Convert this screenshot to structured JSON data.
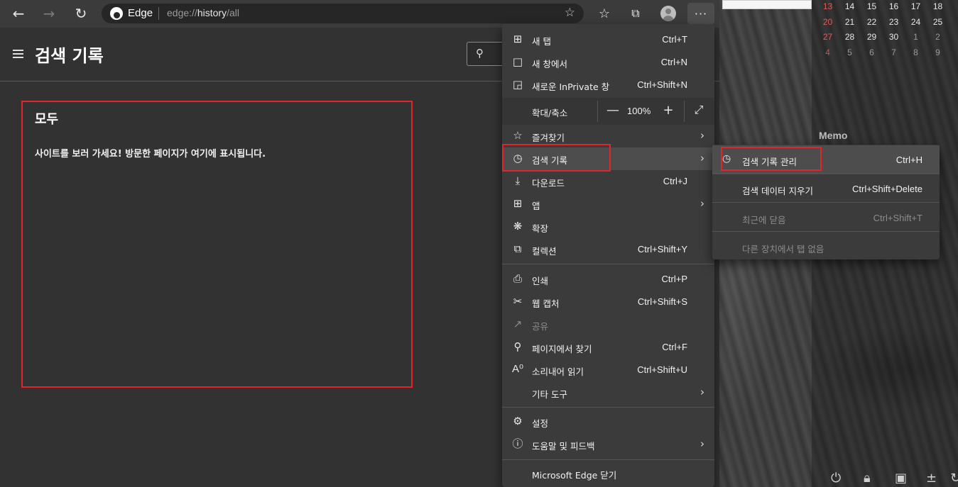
{
  "toolbar": {
    "back_icon": "back-arrow-icon",
    "edge_name": "Edge",
    "url_prefix": "edge://",
    "url_host": "history",
    "url_path": "/all",
    "more_label": "···"
  },
  "page": {
    "title": "검색 기록",
    "section_title": "모두",
    "empty_message": "사이트를 보러 가세요! 방문한 페이지가 여기에 표시됩니다."
  },
  "menu": {
    "new_tab": {
      "label": "새 탭",
      "shortcut": "Ctrl+T"
    },
    "new_window": {
      "label": "새 창에서",
      "shortcut": "Ctrl+N"
    },
    "new_inprivate": {
      "label": "새로운 InPrivate 창",
      "shortcut": "Ctrl+Shift+N"
    },
    "zoom": {
      "label": "확대/축소",
      "value": "100%"
    },
    "favorites": {
      "label": "즐겨찾기"
    },
    "history": {
      "label": "검색 기록"
    },
    "downloads": {
      "label": "다운로드",
      "shortcut": "Ctrl+J"
    },
    "apps": {
      "label": "앱"
    },
    "extensions": {
      "label": "확장"
    },
    "collections": {
      "label": "컬렉션",
      "shortcut": "Ctrl+Shift+Y"
    },
    "print": {
      "label": "인쇄",
      "shortcut": "Ctrl+P"
    },
    "web_capture": {
      "label": "웹 캡처",
      "shortcut": "Ctrl+Shift+S"
    },
    "share": {
      "label": "공유"
    },
    "find": {
      "label": "페이지에서 찾기",
      "shortcut": "Ctrl+F"
    },
    "read_aloud": {
      "label": "소리내어 읽기",
      "shortcut": "Ctrl+Shift+U"
    },
    "more_tools": {
      "label": "기타 도구"
    },
    "settings": {
      "label": "설정"
    },
    "help": {
      "label": "도움말 및 피드백"
    },
    "close": {
      "label": "Microsoft Edge 닫기"
    }
  },
  "submenu": {
    "manage_history": {
      "label": "검색 기록 관리",
      "shortcut": "Ctrl+H"
    },
    "clear_data": {
      "label": "검색 데이터 지우기",
      "shortcut": "Ctrl+Shift+Delete"
    },
    "recently_closed": {
      "label": "최근에 닫음",
      "shortcut": "Ctrl+Shift+T"
    },
    "other_devices": {
      "label": "다른 장치에서 탭 없음"
    }
  },
  "desktop": {
    "calendar": {
      "rows": [
        [
          "13",
          "14",
          "15",
          "16",
          "17",
          "18"
        ],
        [
          "20",
          "21",
          "22",
          "23",
          "24",
          "25"
        ],
        [
          "27",
          "28",
          "29",
          "30",
          "1",
          "2"
        ],
        [
          "4",
          "5",
          "6",
          "7",
          "8",
          "9"
        ]
      ]
    },
    "memo_label": "Memo"
  },
  "colors": {
    "highlight_red": "#e0262b",
    "menu_bg": "#3b3b3b",
    "page_bg": "#323232"
  }
}
